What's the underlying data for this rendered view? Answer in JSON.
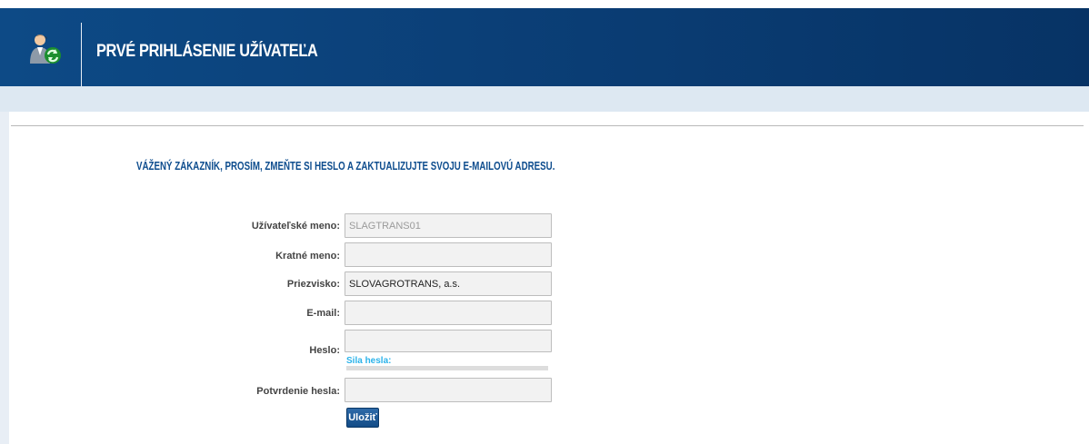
{
  "header": {
    "title": "PRVÉ PRIHLÁSENIE UŽÍVATEĽA",
    "icon": "user-refresh-icon",
    "background": "#0b3f77"
  },
  "notice": "VÁŽENÝ ZÁKAZNÍK, PROSÍM, ZMEŇTE SI HESLO A ZAKTUALIZUJTE SVOJU E-MAILOVÚ ADRESU.",
  "form": {
    "username": {
      "label": "Užívateľské meno:",
      "value": "SLAGTRANS01"
    },
    "first_name": {
      "label": "Kratné meno:",
      "value": ""
    },
    "last_name": {
      "label": "Priezvisko:",
      "value": "SLOVAGROTRANS, a.s."
    },
    "email": {
      "label": "E-mail:",
      "value": ""
    },
    "password": {
      "label": "Heslo:",
      "value": ""
    },
    "password_strength": {
      "label": "Sila hesla:",
      "level": 0
    },
    "password_confirm": {
      "label": "Potvrdenie hesla:",
      "value": ""
    },
    "save_label": "Uložiť"
  },
  "colors": {
    "accent": "#0e4d8e",
    "strength": "#2bb3ea"
  }
}
